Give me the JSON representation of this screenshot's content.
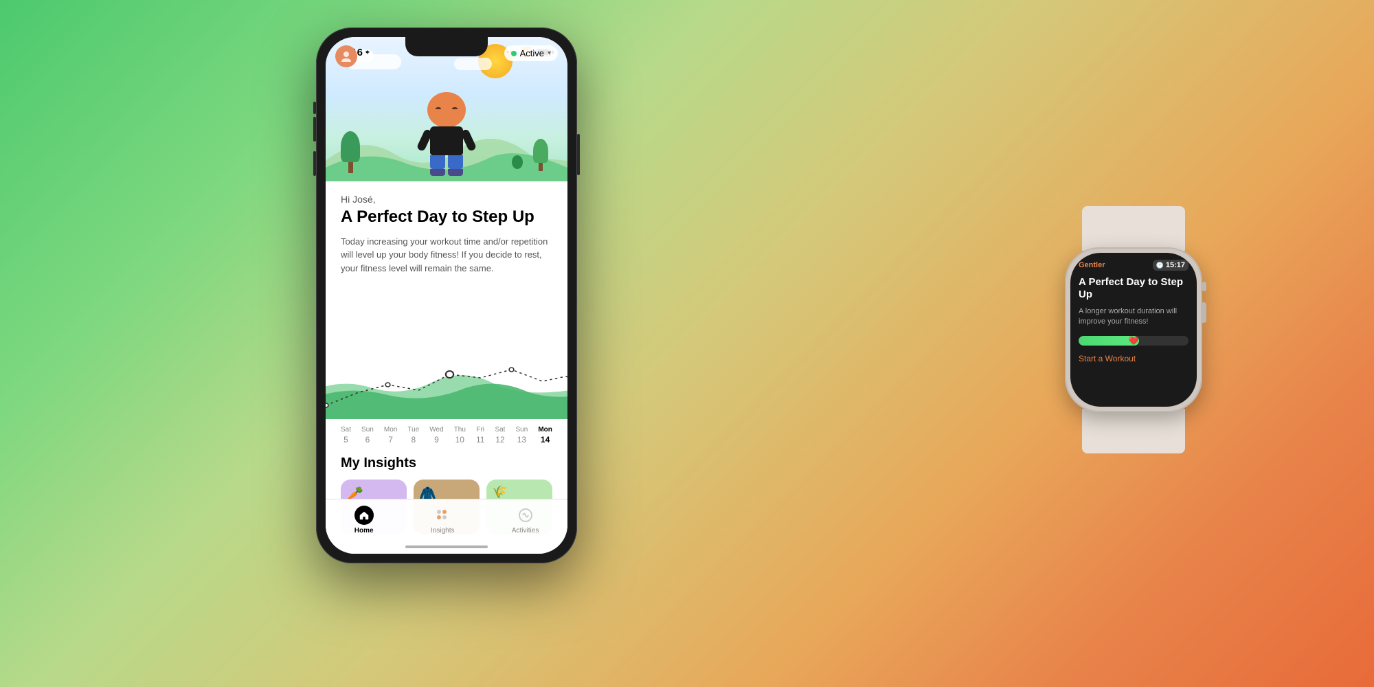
{
  "background": {
    "gradient": "linear-gradient(135deg, #4dc96e 0%, #7ed87f 20%, #b8d98a 35%, #d4c97a 50%, #e8a85a 70%, #e86b3a 100%)"
  },
  "phone": {
    "status": {
      "time": "3:16",
      "signal": "●●●",
      "wifi": "wifi",
      "battery": "battery"
    },
    "active_badge": "Active",
    "greeting": "Hi José,",
    "title": "A Perfect Day to Step Up",
    "description": "Today increasing your workout time and/or repetition will level up your body fitness! If you decide to rest, your fitness level will remain the same.",
    "chart_label": "fitness chart",
    "dates": [
      {
        "day": "Sat",
        "num": "5"
      },
      {
        "day": "Sun",
        "num": "6"
      },
      {
        "day": "Mon",
        "num": "7"
      },
      {
        "day": "Tue",
        "num": "8"
      },
      {
        "day": "Wed",
        "num": "9"
      },
      {
        "day": "Thu",
        "num": "10"
      },
      {
        "day": "Fri",
        "num": "11"
      },
      {
        "day": "Sat",
        "num": "12"
      },
      {
        "day": "Sun",
        "num": "13"
      },
      {
        "day": "Mon",
        "num": "14",
        "active": true
      }
    ],
    "insights_title": "My Insights",
    "tabs": [
      {
        "label": "Home",
        "active": true
      },
      {
        "label": "Insights",
        "active": false
      },
      {
        "label": "Activities",
        "active": false
      }
    ]
  },
  "watch": {
    "app_name": "Gentler",
    "time": "15:17",
    "title": "A Perfect Day to Step Up",
    "description": "A longer workout duration will improve your fitness!",
    "progress_percent": 55,
    "cta": "Start a Workout"
  }
}
